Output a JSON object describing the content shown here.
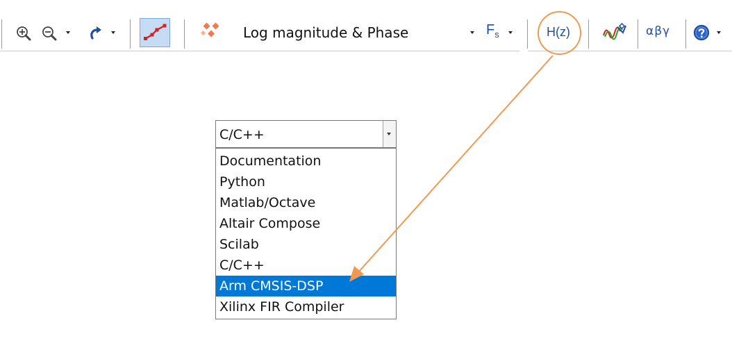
{
  "toolbar": {
    "zoom_in_icon": "zoom-in-icon",
    "zoom_out_icon": "zoom-out-icon",
    "redo_icon": "redo-icon",
    "route_icon": "line-route-icon",
    "points_icon": "scatter-points-icon",
    "view_mode_value": "Log magnitude & Phase",
    "fs_label": "F",
    "fs_sub": "s",
    "hz_label": "H(z)",
    "signal_icon": "signal-waves-icon",
    "greek_label": "αβγ",
    "help_icon": "help-icon"
  },
  "dropdown": {
    "selected": "C/C++",
    "options": [
      "Documentation",
      "Python",
      "Matlab/Octave",
      "Altair Compose",
      "Scilab",
      "C/C++",
      "Arm CMSIS-DSP",
      "Xilinx FIR Compiler"
    ],
    "highlighted": "Arm CMSIS-DSP"
  },
  "colors": {
    "annotation": "#f0994f",
    "highlight": "#0078d7",
    "icon_blue": "#1f4fa0",
    "toolbar_active": "#c6dcf4"
  }
}
